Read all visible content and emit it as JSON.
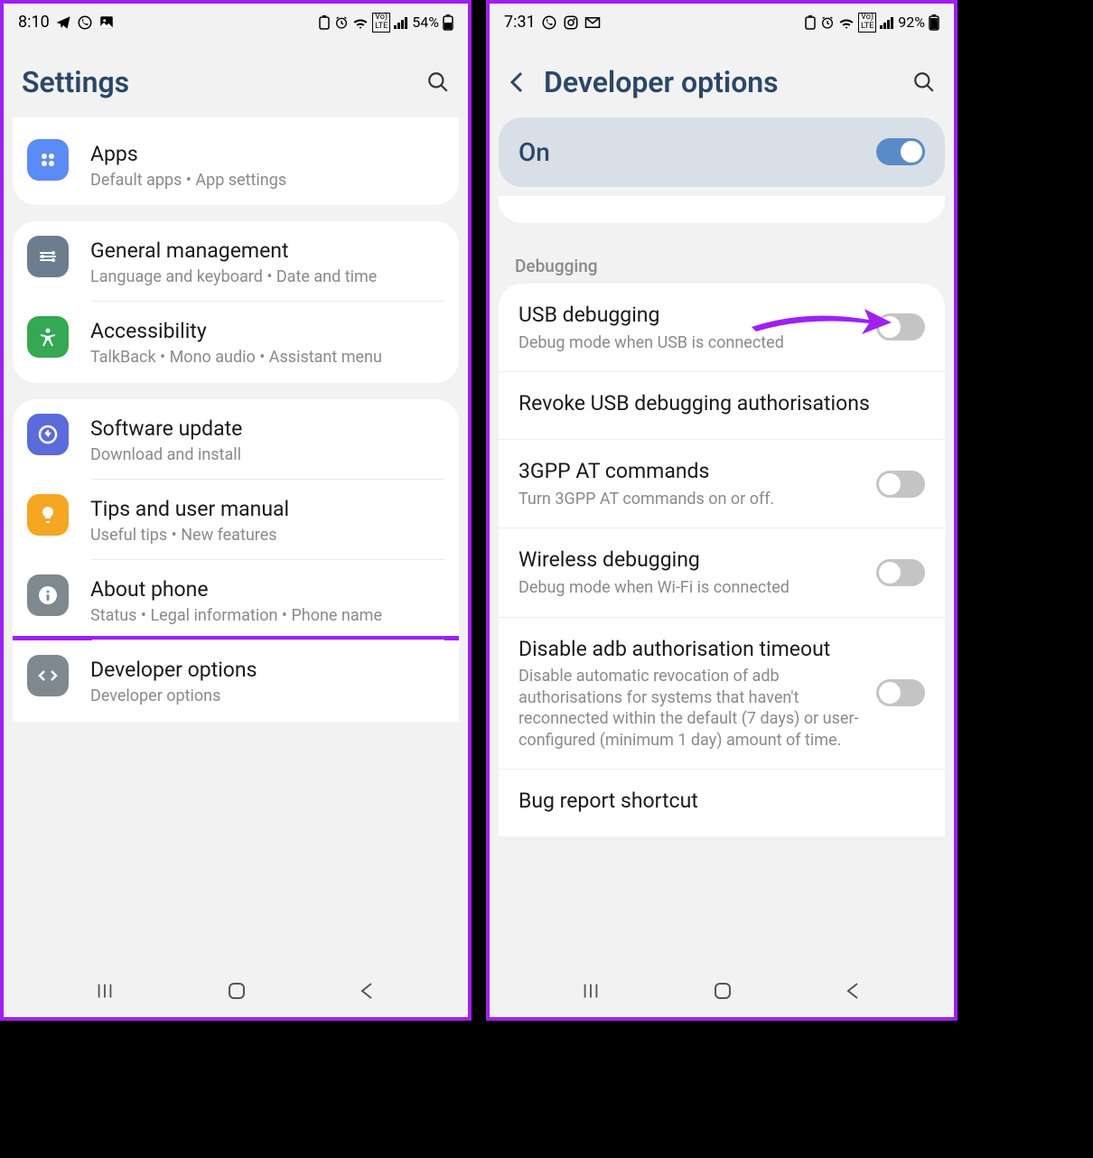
{
  "left": {
    "status": {
      "time": "8:10",
      "battery": "54%"
    },
    "header": {
      "title": "Settings"
    },
    "items": {
      "apps": {
        "title": "Apps",
        "sub": "Default apps  •  App settings"
      },
      "general": {
        "title": "General management",
        "sub": "Language and keyboard  •  Date and time"
      },
      "accessibility": {
        "title": "Accessibility",
        "sub": "TalkBack  •  Mono audio  •  Assistant menu"
      },
      "software": {
        "title": "Software update",
        "sub": "Download and install"
      },
      "tips": {
        "title": "Tips and user manual",
        "sub": "Useful tips  •  New features"
      },
      "about": {
        "title": "About phone",
        "sub": "Status  •  Legal information  •  Phone name"
      },
      "developer": {
        "title": "Developer options",
        "sub": "Developer options"
      }
    }
  },
  "right": {
    "status": {
      "time": "7:31",
      "battery": "92%"
    },
    "header": {
      "title": "Developer options"
    },
    "master_toggle": {
      "label": "On",
      "state": "on"
    },
    "section": "Debugging",
    "options": {
      "usb": {
        "title": "USB debugging",
        "sub": "Debug mode when USB is connected",
        "toggle": "off"
      },
      "revoke": {
        "title": "Revoke USB debugging authorisations"
      },
      "at": {
        "title": "3GPP AT commands",
        "sub": "Turn 3GPP AT commands on or off.",
        "toggle": "off"
      },
      "wireless": {
        "title": "Wireless debugging",
        "sub": "Debug mode when Wi-Fi is connected",
        "toggle": "off"
      },
      "adb": {
        "title": "Disable adb authorisation timeout",
        "sub": "Disable automatic revocation of adb authorisations for systems that haven't reconnected within the default (7 days) or user-configured (minimum 1 day) amount of time.",
        "toggle": "off"
      },
      "bug": {
        "title": "Bug report shortcut"
      }
    }
  }
}
